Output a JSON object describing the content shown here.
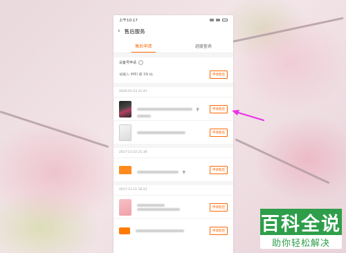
{
  "status_bar": {
    "time": "上午10:17"
  },
  "nav": {
    "back_icon": "‹",
    "title": "售后服务"
  },
  "tabs": [
    {
      "label": "售后申请",
      "active": true
    },
    {
      "label": "进度查询",
      "active": false
    }
  ],
  "device_query": {
    "label": "设备号申请",
    "placeholder": "请输入 IMEI 或 SN 码",
    "button": "申请售后"
  },
  "orders": [
    {
      "date": "2020-01-23 21:41",
      "items": [
        {
          "thumb": "phone-dark",
          "label": "子",
          "button": "申请售后"
        },
        {
          "thumb": "phone-light",
          "label": "",
          "button": "申请售后"
        }
      ]
    },
    {
      "date": "2017-11-22 21:36",
      "items": [
        {
          "thumb": "card-orange",
          "label": "卡",
          "button": "申请售后"
        }
      ]
    },
    {
      "date": "2017-11-11 10:21",
      "items": [
        {
          "thumb": "phone-pink",
          "label": "",
          "button": "申请售后"
        },
        {
          "thumb": "mi-logo",
          "label": "",
          "button": "申请售后"
        }
      ]
    }
  ],
  "watermark": {
    "top": "百科全说",
    "bottom": "助你轻松解决"
  },
  "colors": {
    "accent": "#ff6700",
    "arrow": "#e830e8",
    "watermark_green": "#2e9e4a"
  }
}
